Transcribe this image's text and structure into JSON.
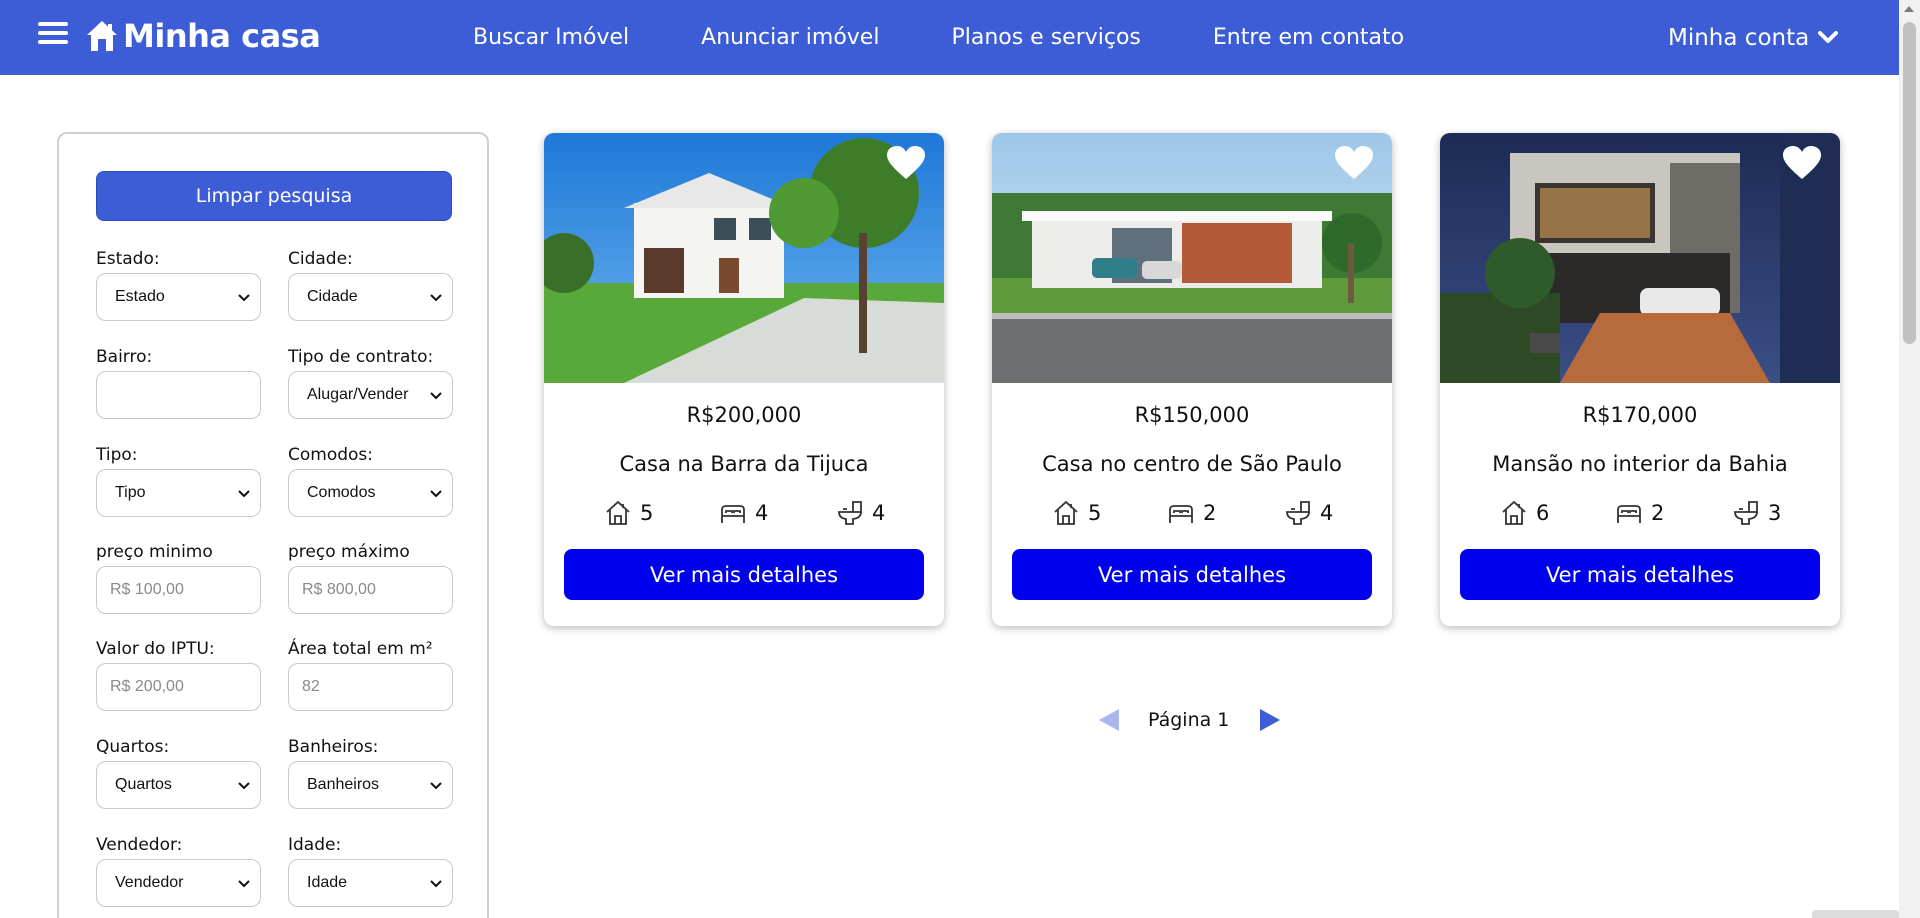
{
  "header": {
    "brand": "Minha casa",
    "nav": [
      "Buscar Imóvel",
      "Anunciar imóvel",
      "Planos e serviços",
      "Entre em contato"
    ],
    "account": "Minha conta"
  },
  "colors": {
    "header_bg": "#3c5dd6",
    "primary_button": "#0000ee",
    "clear_button": "#3c5dd6"
  },
  "filters": {
    "clear_label": "Limpar pesquisa",
    "estado": {
      "label": "Estado:",
      "value": "Estado"
    },
    "cidade": {
      "label": "Cidade:",
      "value": "Cidade"
    },
    "bairro": {
      "label": "Bairro:",
      "value": ""
    },
    "contrato": {
      "label": "Tipo de contrato:",
      "value": "Alugar/Vender"
    },
    "tipo": {
      "label": "Tipo:",
      "value": "Tipo"
    },
    "comodos": {
      "label": "Comodos:",
      "value": "Comodos"
    },
    "preco_min": {
      "label": "preço minimo",
      "placeholder": "R$ 100,00"
    },
    "preco_max": {
      "label": "preço máximo",
      "placeholder": "R$ 800,00"
    },
    "iptu": {
      "label": "Valor do IPTU:",
      "placeholder": "R$ 200,00"
    },
    "area": {
      "label": "Área total em m²",
      "placeholder": "82"
    },
    "quartos": {
      "label": "Quartos:",
      "value": "Quartos"
    },
    "banheiros": {
      "label": "Banheiros:",
      "value": "Banheiros"
    },
    "vendedor": {
      "label": "Vendedor:",
      "value": "Vendedor"
    },
    "idade": {
      "label": "Idade:",
      "value": "Idade"
    }
  },
  "listings": [
    {
      "price": "R$200,000",
      "title": "Casa na Barra da Tijuca",
      "rooms": "5",
      "beds": "4",
      "baths": "4",
      "button": "Ver mais detalhes"
    },
    {
      "price": "R$150,000",
      "title": "Casa no centro de São Paulo",
      "rooms": "5",
      "beds": "2",
      "baths": "4",
      "button": "Ver mais detalhes"
    },
    {
      "price": "R$170,000",
      "title": "Mansão no interior da Bahia",
      "rooms": "6",
      "beds": "2",
      "baths": "3",
      "button": "Ver mais detalhes"
    }
  ],
  "pagination": {
    "label": "Página 1"
  },
  "icons": [
    "menu-icon",
    "house-icon",
    "chevron-down-icon",
    "heart-icon",
    "rooms-icon",
    "bed-icon",
    "toilet-icon",
    "arrow-left-icon",
    "arrow-right-icon"
  ]
}
